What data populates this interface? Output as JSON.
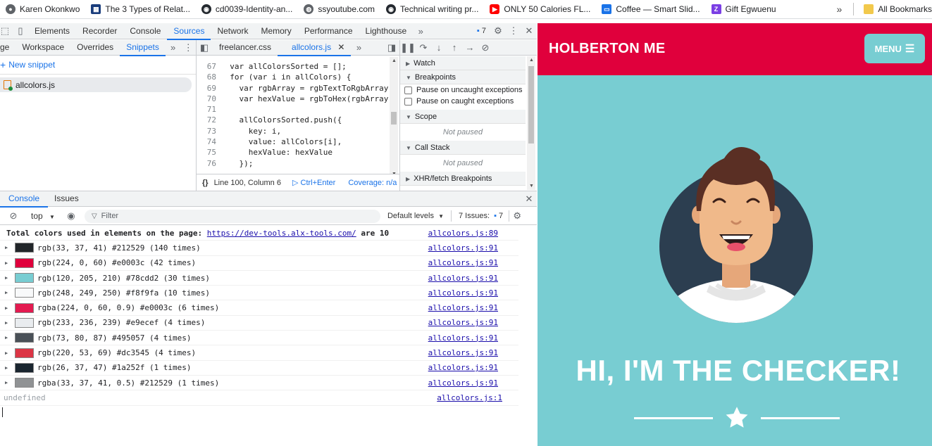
{
  "bookmarks": {
    "items": [
      {
        "label": "Karen Okonkwo",
        "icon": "person-icon",
        "color": "#5f6368"
      },
      {
        "label": "The 3 Types of Relat...",
        "icon": "grid-icon",
        "color": "#1a3d7c"
      },
      {
        "label": "cd0039-Identity-an...",
        "icon": "github-icon",
        "color": "#24292f"
      },
      {
        "label": "ssyoutube.com",
        "icon": "globe-icon",
        "color": "#5f6368"
      },
      {
        "label": "Technical writing pr...",
        "icon": "github-icon",
        "color": "#24292f"
      },
      {
        "label": "ONLY 50 Calories FL...",
        "icon": "youtube-icon",
        "color": "#ff0000"
      },
      {
        "label": "Coffee — Smart Slid...",
        "icon": "slides-icon",
        "color": "#1a73e8"
      },
      {
        "label": "Gift Egwuenu",
        "icon": "zeplin-icon",
        "color": "#7b3fe4"
      }
    ],
    "more": "»",
    "all_bookmarks": "All Bookmarks"
  },
  "devtools": {
    "main_tabs": [
      "Elements",
      "Recorder",
      "Console",
      "Sources",
      "Network",
      "Memory",
      "Performance",
      "Lighthouse"
    ],
    "active_main_tab": "Sources",
    "issues_badge": "7",
    "nav_tabs": {
      "partial": "ge",
      "workspace": "Workspace",
      "overrides": "Overrides",
      "snippets": "Snippets"
    },
    "new_snippet": "New snippet",
    "snippet_file": "allcolors.js",
    "editor_tabs": [
      "freelancer.css",
      "allcolors.js"
    ],
    "code": [
      {
        "n": "67",
        "text": "  var allColorsSorted = [];"
      },
      {
        "n": "68",
        "text": "  for (var i in allColors) {"
      },
      {
        "n": "69",
        "text": "    var rgbArray = rgbTextToRgbArray("
      },
      {
        "n": "70",
        "text": "    var hexValue = rgbToHex(rgbArray)"
      },
      {
        "n": "71",
        "text": ""
      },
      {
        "n": "72",
        "text": "    allColorsSorted.push({"
      },
      {
        "n": "73",
        "text": "      key: i,"
      },
      {
        "n": "74",
        "text": "      value: allColors[i],"
      },
      {
        "n": "75",
        "text": "      hexValue: hexValue"
      },
      {
        "n": "76",
        "text": "    });"
      }
    ],
    "status_bar": {
      "position": "Line 100, Column 6",
      "run": "Ctrl+Enter",
      "coverage": "Coverage: n/a"
    },
    "debugger": {
      "watch": "Watch",
      "breakpoints": "Breakpoints",
      "pause_uncaught": "Pause on uncaught exceptions",
      "pause_caught": "Pause on caught exceptions",
      "scope": "Scope",
      "scope_state": "Not paused",
      "call_stack": "Call Stack",
      "call_stack_state": "Not paused",
      "xhr": "XHR/fetch Breakpoints"
    },
    "drawer_tabs": [
      "Console",
      "Issues"
    ],
    "console_toolbar": {
      "context": "top",
      "filter_placeholder": "Filter",
      "levels": "Default levels",
      "issues_label": "7 Issues:",
      "issues_count": "7"
    },
    "console_header": {
      "text": "Total colors used in elements on the page: ",
      "link": "https://dev-tools.alx-tools.com/",
      "suffix": " are 10",
      "source": "allcolors.js:89"
    },
    "console_rows": [
      {
        "text": "rgb(33, 37, 41) #212529 (140 times)",
        "swatch": "#212529",
        "source": "allcolors.js:91"
      },
      {
        "text": "rgb(224, 0, 60) #e0003c (42 times)",
        "swatch": "#e0003c",
        "source": "allcolors.js:91"
      },
      {
        "text": "rgb(120, 205, 210) #78cdd2 (30 times)",
        "swatch": "#78cdd2",
        "source": "allcolors.js:91"
      },
      {
        "text": "rgb(248, 249, 250) #f8f9fa (10 times)",
        "swatch": "#f8f9fa",
        "source": "allcolors.js:91"
      },
      {
        "text": "rgba(224, 0, 60, 0.9) #e0003c (6 times)",
        "swatch": "#e31a50",
        "source": "allcolors.js:91"
      },
      {
        "text": "rgb(233, 236, 239) #e9ecef (4 times)",
        "swatch": "#e9ecef",
        "source": "allcolors.js:91"
      },
      {
        "text": "rgb(73, 80, 87) #495057 (4 times)",
        "swatch": "#495057",
        "source": "allcolors.js:91"
      },
      {
        "text": "rgb(220, 53, 69) #dc3545 (4 times)",
        "swatch": "#dc3545",
        "source": "allcolors.js:91"
      },
      {
        "text": "rgb(26, 37, 47) #1a252f (1 times)",
        "swatch": "#1a252f",
        "source": "allcolors.js:91"
      },
      {
        "text": "rgba(33, 37, 41, 0.5) #212529 (1 times)",
        "swatch": "#909294",
        "source": "allcolors.js:91"
      }
    ],
    "console_undefined": "undefined",
    "console_undefined_source": "allcolors.js:1"
  },
  "site": {
    "logo": "HOLBERTON ME",
    "menu": "MENU",
    "hero_title": "HI, I'M THE CHECKER!",
    "colors": {
      "primary": "#e0003c",
      "accent": "#78cdd2",
      "dark": "#2c3e50"
    }
  }
}
